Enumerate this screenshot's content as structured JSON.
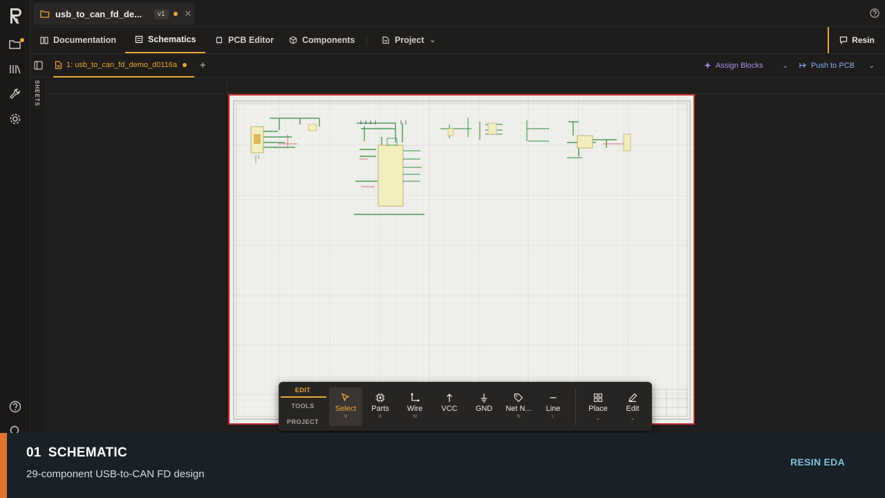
{
  "file_tab": {
    "name": "usb_to_can_fd_de...",
    "version": "v1"
  },
  "nav": {
    "tabs": [
      {
        "label": "Documentation",
        "icon": "book-icon"
      },
      {
        "label": "Schematics",
        "icon": "schematic-icon",
        "active": true
      },
      {
        "label": "PCB Editor",
        "icon": "chip-icon"
      },
      {
        "label": "Components",
        "icon": "cube-icon"
      },
      {
        "label": "Project",
        "icon": "project-icon"
      }
    ],
    "resin_label": "Resin"
  },
  "sheet_tab": {
    "label": "1: usb_to_can_fd_demo_d0116a"
  },
  "actions": {
    "assign_blocks": "Assign Blocks",
    "push_to_pcb": "Push to PCB"
  },
  "sheets_panel": {
    "label": "SHEETS"
  },
  "toolbar": {
    "categories": [
      "EDIT",
      "TOOLS",
      "PROJECT"
    ],
    "active_category": "EDIT",
    "tools": [
      {
        "label": "Select",
        "key": "V",
        "icon": "cursor-icon"
      },
      {
        "label": "Parts",
        "key": "A",
        "icon": "chip-icon"
      },
      {
        "label": "Wire",
        "key": "W",
        "icon": "wire-icon"
      },
      {
        "label": "VCC",
        "key": "",
        "icon": "vcc-arrow-icon"
      },
      {
        "label": "GND",
        "key": "",
        "icon": "ground-icon"
      },
      {
        "label": "Net N...",
        "key": "N",
        "icon": "tag-icon"
      },
      {
        "label": "Line",
        "key": "L",
        "icon": "line-icon"
      },
      {
        "label": "Place",
        "key": "",
        "icon": "grid-icon"
      },
      {
        "label": "Edit",
        "key": "",
        "icon": "pencil-icon"
      }
    ]
  },
  "caption": {
    "number": "01",
    "title": "SCHEMATIC",
    "subtitle": "29-component USB-to-CAN FD design",
    "brand": "RESIN EDA"
  },
  "colors": {
    "accent": "#e8a83a",
    "assign": "#a994e8",
    "push": "#8fb0ef",
    "sheet_border": "#c62a2a",
    "wire": "#2f8a3a",
    "component": "#f3eebd",
    "caption_bg": "#1a2028",
    "caption_accent": "#e0762f",
    "brand": "#7fc4d8"
  }
}
